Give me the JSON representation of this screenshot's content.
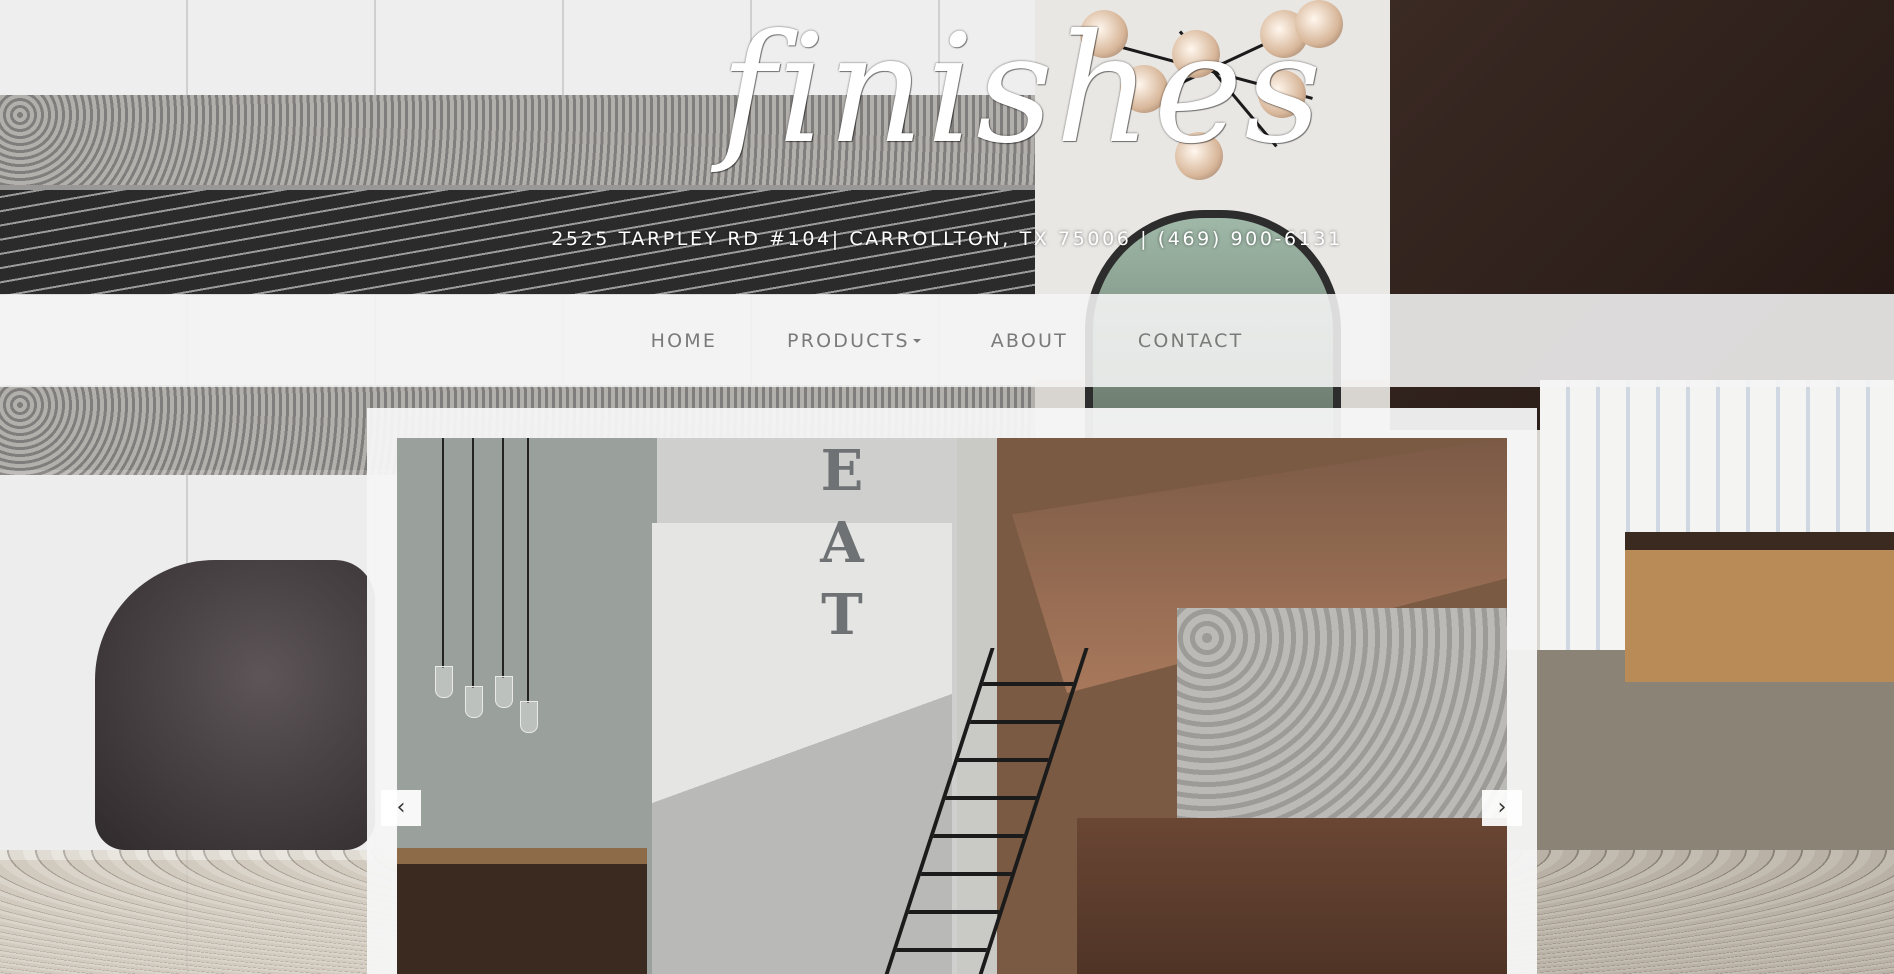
{
  "brand": {
    "logo_text": "finishes",
    "address": "2525 TARPLEY RD #104| CARROLLTON, TX 75006 | (469) 900-6131"
  },
  "nav": {
    "items": [
      {
        "label": "HOME"
      },
      {
        "label": "PRODUCTS",
        "dropdown": true
      },
      {
        "label": "ABOUT"
      },
      {
        "label": "CONTACT"
      }
    ]
  },
  "slider": {
    "prev_label": "‹",
    "next_label": "›",
    "slide_wall_letters": [
      "E",
      "A",
      "T"
    ]
  },
  "colors": {
    "nav_text": "#7a7a7a",
    "nav_bar": "#f5f5f5",
    "logo": "#ffffff"
  },
  "icons": {
    "dropdown": "caret-down-icon",
    "prev": "chevron-left-icon",
    "next": "chevron-right-icon"
  }
}
